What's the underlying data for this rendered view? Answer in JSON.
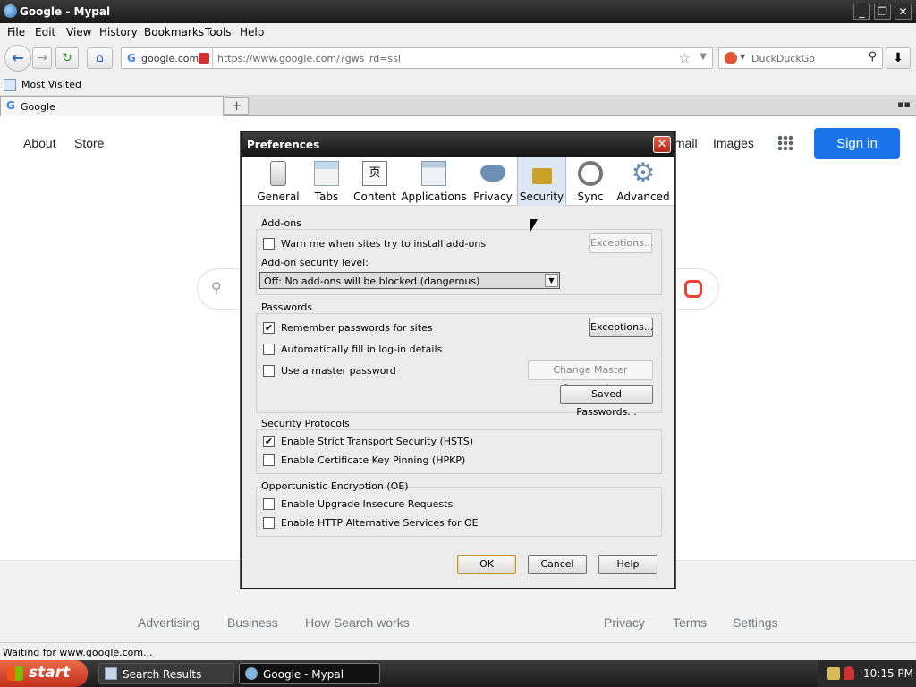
{
  "window": {
    "title": "Google - Mypal"
  },
  "menu": [
    "File",
    "Edit",
    "View",
    "History",
    "Bookmarks",
    "Tools",
    "Help"
  ],
  "nav": {
    "identity_domain": "google.com",
    "url": "https://www.google.com/?gws_rd=ssl",
    "search_placeholder": "DuckDuckGo"
  },
  "bookmarks": {
    "most_visited": "Most Visited"
  },
  "tabs": [
    {
      "title": "Google"
    }
  ],
  "google": {
    "top_left_links": [
      "About",
      "Store"
    ],
    "top_right_links": [
      "Gmail",
      "Images"
    ],
    "sign_in": "Sign in",
    "footer_left": [
      "Advertising",
      "Business",
      "How Search works"
    ],
    "footer_right": [
      "Privacy",
      "Terms",
      "Settings"
    ]
  },
  "status": "Waiting for www.google.com...",
  "taskbar": {
    "start": "start",
    "items": [
      "Search Results",
      "Google - Mypal"
    ],
    "clock": "10:15 PM"
  },
  "dialog": {
    "title": "Preferences",
    "panes": [
      "General",
      "Tabs",
      "Content",
      "Applications",
      "Privacy",
      "Security",
      "Sync",
      "Advanced"
    ],
    "selected_pane": "Security",
    "addons": {
      "title": "Add-ons",
      "warn": {
        "label": "Warn me when sites try to install add-ons",
        "checked": false
      },
      "exceptions": "Exceptions...",
      "level_label": "Add-on security level:",
      "level_value": "Off: No add-ons will be blocked (dangerous)"
    },
    "passwords": {
      "title": "Passwords",
      "remember": {
        "label": "Remember passwords for sites",
        "checked": true
      },
      "autofill": {
        "label": "Automatically fill in log-in details",
        "checked": false
      },
      "master": {
        "label": "Use a master password",
        "checked": false
      },
      "exceptions": "Exceptions...",
      "change_master": "Change Master Password...",
      "saved": "Saved Passwords..."
    },
    "protocols": {
      "title": "Security Protocols",
      "hsts": {
        "label": "Enable Strict Transport Security (HSTS)",
        "checked": true
      },
      "hpkp": {
        "label": "Enable Certificate Key Pinning (HPKP)",
        "checked": false
      }
    },
    "oe": {
      "title": "Opportunistic Encryption (OE)",
      "upgrade": {
        "label": "Enable Upgrade Insecure Requests",
        "checked": false
      },
      "altsvc": {
        "label": "Enable HTTP Alternative Services for OE",
        "checked": false
      }
    },
    "buttons": {
      "ok": "OK",
      "cancel": "Cancel",
      "help": "Help"
    }
  }
}
